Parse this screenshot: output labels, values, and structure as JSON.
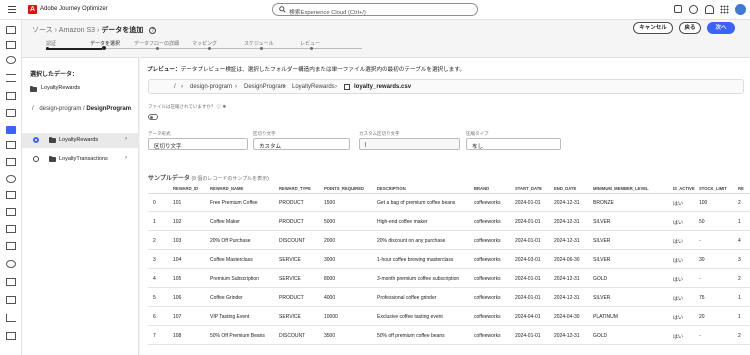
{
  "app": {
    "title": "Adobe Journey Optimizer",
    "logo_letter": "A"
  },
  "search": {
    "placeholder": "検索Experience Cloud (Ctrl+/)"
  },
  "header": {
    "breadcrumb_1": "ソース",
    "breadcrumb_2": "Amazon S3",
    "page_title": "データを追加",
    "help": "?",
    "cancel_label": "キャンセル",
    "back_label": "戻る",
    "next_label": "次へ"
  },
  "steps": [
    {
      "label": "認証"
    },
    {
      "label": "データを選択"
    },
    {
      "label": "データフローの詳細"
    },
    {
      "label": "マッピング"
    },
    {
      "label": "スケジュール"
    },
    {
      "label": "レビュー"
    }
  ],
  "left_panel": {
    "title": "選択したデータ：",
    "folder": "LoyaltyRewards",
    "path_sep": "/",
    "path_1": "design-program",
    "path_2": "DesignProgram",
    "items": [
      {
        "label": "LoyaltyRewards",
        "selected": true
      },
      {
        "label": "LoyaltyTransactions",
        "selected": false
      }
    ]
  },
  "main": {
    "preview_prefix": "プレビュー：",
    "preview_text": "データプレビュー検証は、選択したフォルダー構造内または単一ファイル選択内の最初のテーブルを選択します。",
    "file_path": {
      "sep": "/",
      "p1": "design-program",
      "p2": "DesignProgram",
      "p3": "LoyaltyRewards",
      "file": "loyalty_rewards.csv"
    },
    "toggle_label": "ファイルは圧縮されていますか？",
    "fields": [
      {
        "label": "データ形式",
        "value": "区切り文字"
      },
      {
        "label": "区切り文字",
        "value": "カスタム"
      },
      {
        "label": "カスタム区切り文字",
        "value": "|"
      },
      {
        "label": "圧縮タイプ",
        "value": "なし"
      }
    ],
    "sample_title": "サンプルデータ",
    "sample_note": "(8 個のレコードのサンプルを表示)"
  },
  "table": {
    "columns": [
      "",
      "REWARD_ID",
      "REWARD_NAME",
      "REWARD_TYPE",
      "POINTS_REQUIRED",
      "DESCRIPTION",
      "BRAND",
      "START_DATE",
      "END_DATE",
      "MINIMUM_MEMBER_LEVEL",
      "IS_ACTIVE",
      "STOCK_LIMIT",
      "RE"
    ],
    "rows": [
      [
        "0",
        "101",
        "Free Premium Coffee",
        "PRODUCT",
        "1500",
        "Get a bag of premium coffee beans",
        "coffeeworks",
        "2024-01-01",
        "2024-12-31",
        "BRONZE",
        "はい",
        "100",
        "2"
      ],
      [
        "1",
        "102",
        "Coffee Maker",
        "PRODUCT",
        "5000",
        "High-end coffee maker",
        "coffeeworks",
        "2024-01-01",
        "2024-12-31",
        "SILVER",
        "はい",
        "50",
        "1"
      ],
      [
        "2",
        "103",
        "20% Off Purchase",
        "DISCOUNT",
        "2000",
        "20% discount on any purchase",
        "coffeeworks",
        "2024-01-01",
        "2024-12-31",
        "SILVER",
        "はい",
        "-",
        "4"
      ],
      [
        "3",
        "104",
        "Coffee Masterclass",
        "SERVICE",
        "3000",
        "1-hour coffee brewing masterclass",
        "coffeeworks",
        "2024-03-01",
        "2024-06-30",
        "SILVER",
        "はい",
        "30",
        "3"
      ],
      [
        "4",
        "105",
        "Premium Subscription",
        "SERVICE",
        "8000",
        "3-month premium coffee subscription",
        "coffeeworks",
        "2024-01-01",
        "2024-12-31",
        "GOLD",
        "はい",
        "-",
        "2"
      ],
      [
        "5",
        "106",
        "Coffee Grinder",
        "PRODUCT",
        "4000",
        "Professional coffee grinder",
        "coffeeworks",
        "2024-01-01",
        "2024-12-31",
        "SILVER",
        "はい",
        "75",
        "1"
      ],
      [
        "6",
        "107",
        "VIP Tasting Event",
        "SERVICE",
        "10000",
        "Exclusive coffee tasting event",
        "coffeeworks",
        "2024-04-01",
        "2024-04-30",
        "PLATINUM",
        "はい",
        "20",
        "1"
      ],
      [
        "7",
        "108",
        "50% Off Premium Beans",
        "DISCOUNT",
        "3500",
        "50% off premium coffee beans",
        "coffeeworks",
        "2024-01-01",
        "2024-12-31",
        "GOLD",
        "はい",
        "-",
        "2"
      ]
    ]
  }
}
